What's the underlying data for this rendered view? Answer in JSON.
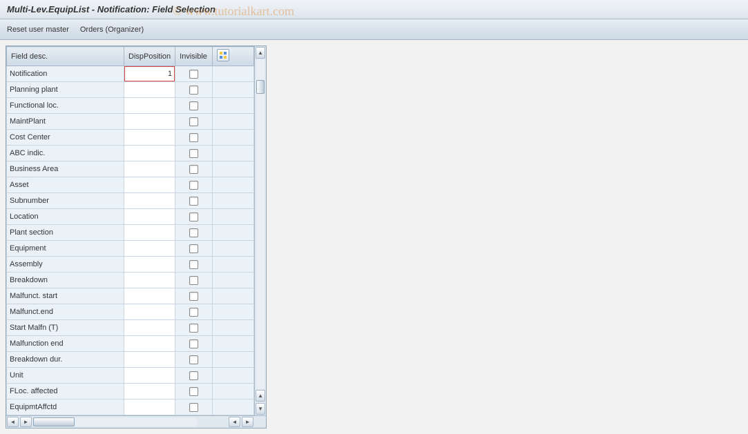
{
  "header": {
    "title": "Multi-Lev.EquipList - Notification: Field Selection"
  },
  "toolbar": {
    "reset_user_master": "Reset user master",
    "orders_organizer": "Orders (Organizer)"
  },
  "watermark": "© www.tutorialkart.com",
  "table": {
    "columns": {
      "field_desc": "Field desc.",
      "disp_position": "DispPosition",
      "invisible": "Invisible"
    },
    "rows": [
      {
        "field_desc": "Notification",
        "disp_position": "1",
        "invisible": false,
        "highlighted": true
      },
      {
        "field_desc": "Planning plant",
        "disp_position": "",
        "invisible": false
      },
      {
        "field_desc": "Functional loc.",
        "disp_position": "",
        "invisible": false
      },
      {
        "field_desc": "MaintPlant",
        "disp_position": "",
        "invisible": false
      },
      {
        "field_desc": "Cost Center",
        "disp_position": "",
        "invisible": false
      },
      {
        "field_desc": "ABC indic.",
        "disp_position": "",
        "invisible": false
      },
      {
        "field_desc": "Business Area",
        "disp_position": "",
        "invisible": false
      },
      {
        "field_desc": "Asset",
        "disp_position": "",
        "invisible": false
      },
      {
        "field_desc": "Subnumber",
        "disp_position": "",
        "invisible": false
      },
      {
        "field_desc": "Location",
        "disp_position": "",
        "invisible": false
      },
      {
        "field_desc": "Plant section",
        "disp_position": "",
        "invisible": false
      },
      {
        "field_desc": "Equipment",
        "disp_position": "",
        "invisible": false
      },
      {
        "field_desc": "Assembly",
        "disp_position": "",
        "invisible": false
      },
      {
        "field_desc": "Breakdown",
        "disp_position": "",
        "invisible": false
      },
      {
        "field_desc": "Malfunct. start",
        "disp_position": "",
        "invisible": false
      },
      {
        "field_desc": "Malfunct.end",
        "disp_position": "",
        "invisible": false
      },
      {
        "field_desc": "Start Malfn (T)",
        "disp_position": "",
        "invisible": false
      },
      {
        "field_desc": "Malfunction end",
        "disp_position": "",
        "invisible": false
      },
      {
        "field_desc": "Breakdown dur.",
        "disp_position": "",
        "invisible": false
      },
      {
        "field_desc": "Unit",
        "disp_position": "",
        "invisible": false
      },
      {
        "field_desc": "FLoc. affected",
        "disp_position": "",
        "invisible": false
      },
      {
        "field_desc": "EquipmtAffctd",
        "disp_position": "",
        "invisible": false
      }
    ]
  }
}
